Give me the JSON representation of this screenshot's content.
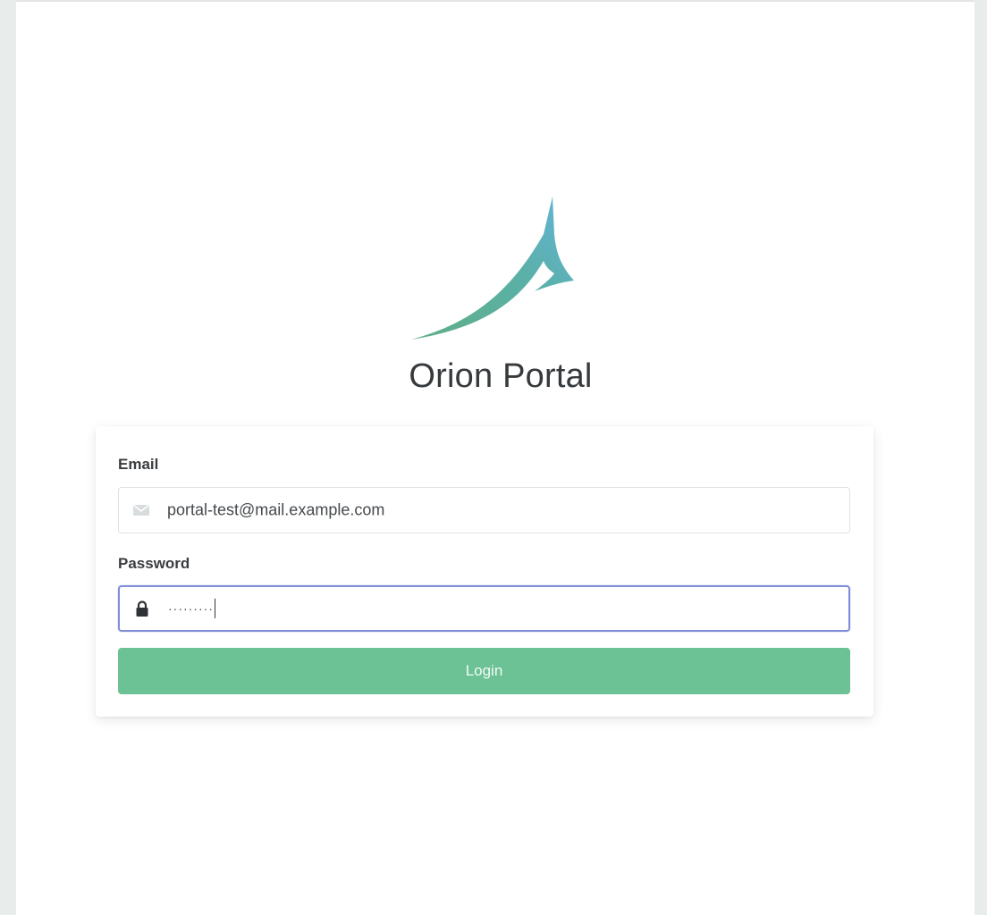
{
  "app": {
    "title": "Orion Portal"
  },
  "login_form": {
    "email_label": "Email",
    "email_value": "portal-test@mail.example.com",
    "email_icon": "envelope-icon",
    "password_label": "Password",
    "password_mask": "·········",
    "password_icon": "lock-icon",
    "login_button_label": "Login"
  },
  "colors": {
    "brand_green": "#6cc294",
    "focus_border": "#7f8ed6",
    "logo_gradient_start": "#5fae86",
    "logo_gradient_end": "#62b3d8"
  }
}
